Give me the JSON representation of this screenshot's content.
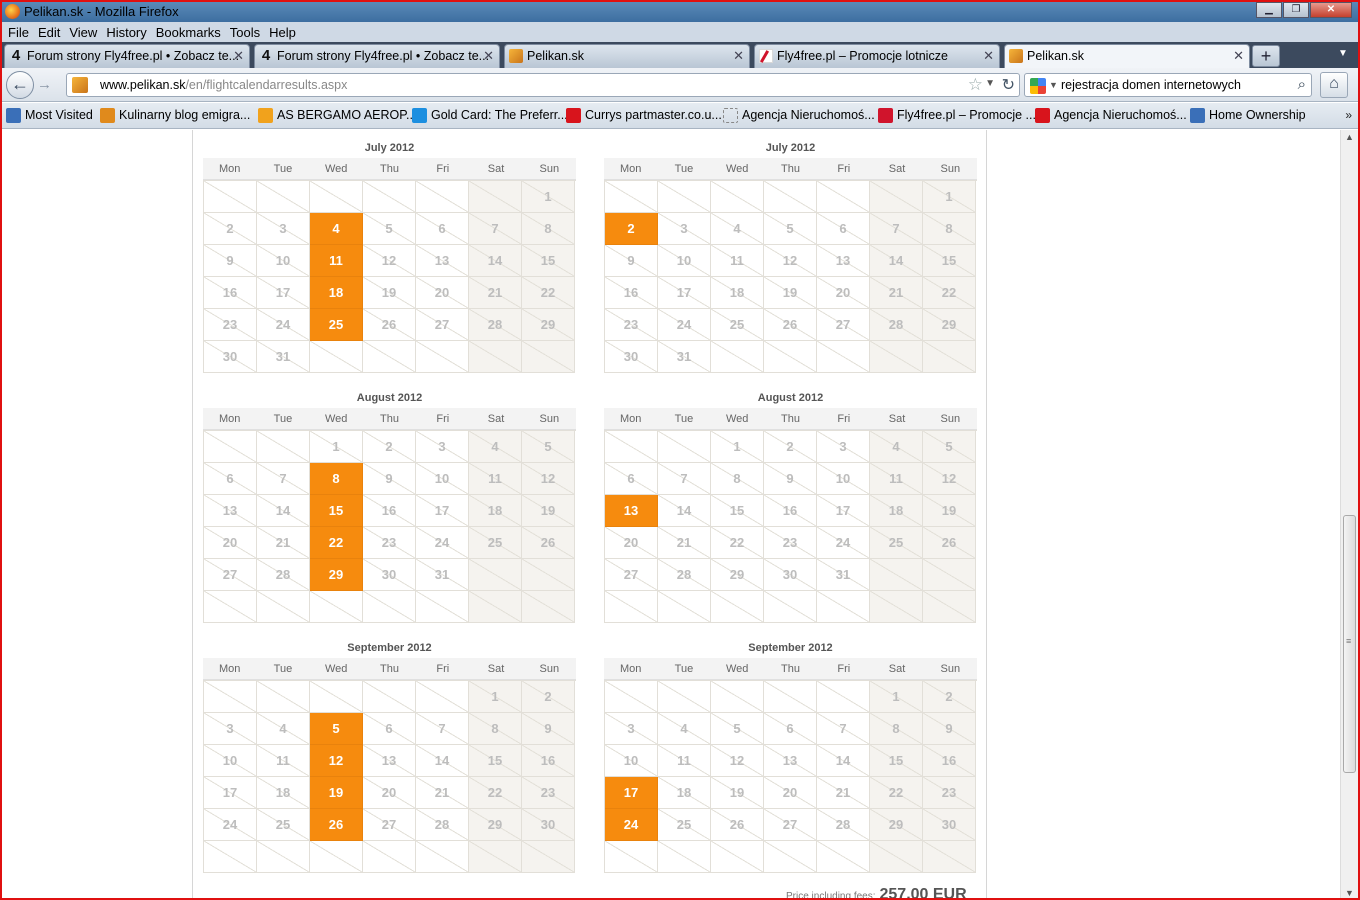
{
  "window": {
    "title": "Pelikan.sk - Mozilla Firefox",
    "min": "▁",
    "max": "❐",
    "close": "✕"
  },
  "menu": [
    "File",
    "Edit",
    "View",
    "History",
    "Bookmarks",
    "Tools",
    "Help"
  ],
  "tabs": [
    {
      "label": "Forum strony Fly4free.pl • Zobacz te...",
      "icon": "fly4free-forum-icon",
      "active": false
    },
    {
      "label": "Forum strony Fly4free.pl • Zobacz te...",
      "icon": "fly4free-forum-icon",
      "active": false
    },
    {
      "label": "Pelikan.sk",
      "icon": "pelikan-icon",
      "active": false
    },
    {
      "label": "Fly4free.pl – Promocje lotnicze",
      "icon": "fly4free-icon",
      "active": false
    },
    {
      "label": "Pelikan.sk",
      "icon": "pelikan-icon",
      "active": true
    }
  ],
  "nav": {
    "url_host": "www.pelikan.sk",
    "url_path": "/en/flightcalendarresults.aspx",
    "search_query": "rejestracja domen internetowych"
  },
  "bookmarks": [
    {
      "label": "Most Visited",
      "color": "#3a6fb8"
    },
    {
      "label": "Kulinarny blog emigra...",
      "color": "#e08a1c"
    },
    {
      "label": "AS BERGAMO AEROP...",
      "color": "#f1a21c"
    },
    {
      "label": "Gold Card: The Preferr...",
      "color": "#1c8fe0"
    },
    {
      "label": "Currys partmaster.co.u...",
      "color": "#d8141c"
    },
    {
      "label": "Agencja Nieruchomoś...",
      "color": "#ffffff"
    },
    {
      "label": "Fly4free.pl – Promocje ...",
      "color": "#d0142c"
    },
    {
      "label": "Agencja Nieruchomoś...",
      "color": "#d8141c"
    },
    {
      "label": "Home Ownership",
      "color": "#3a6fb8"
    }
  ],
  "bookmarks_more": "»",
  "weekdays": [
    "Mon",
    "Tue",
    "Wed",
    "Thu",
    "Fri",
    "Sat",
    "Sun"
  ],
  "calendars": [
    {
      "title": "July 2012",
      "first_weekday": 6,
      "days": 31,
      "highlighted": [
        4,
        11,
        18,
        25
      ]
    },
    {
      "title": "July 2012",
      "first_weekday": 6,
      "days": 31,
      "highlighted": [
        2
      ]
    },
    {
      "title": "August 2012",
      "first_weekday": 2,
      "days": 31,
      "highlighted": [
        8,
        15,
        22,
        29
      ]
    },
    {
      "title": "August 2012",
      "first_weekday": 2,
      "days": 31,
      "highlighted": [
        13
      ]
    },
    {
      "title": "September 2012",
      "first_weekday": 5,
      "days": 30,
      "highlighted": [
        5,
        12,
        19,
        26
      ]
    },
    {
      "title": "September 2012",
      "first_weekday": 5,
      "days": 30,
      "highlighted": [
        17,
        24
      ]
    }
  ],
  "price": {
    "label": "Price including fees:",
    "value": "257,00 EUR"
  },
  "colors": {
    "highlight": "#f68b0e",
    "frame": "#e01010"
  }
}
